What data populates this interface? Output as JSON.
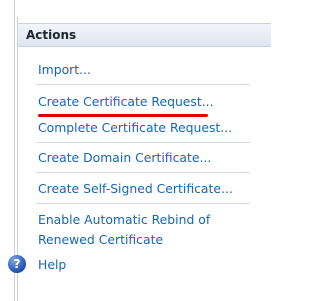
{
  "actions_panel": {
    "title": "Actions",
    "items": [
      {
        "label": "Import..."
      },
      {
        "label": "Create Certificate Request..."
      },
      {
        "label": "Complete Certificate Request..."
      },
      {
        "label": "Create Domain Certificate..."
      },
      {
        "label": "Create Self-Signed Certificate..."
      },
      {
        "label": "Enable Automatic Rebind of Renewed Certificate"
      }
    ],
    "help": {
      "label": "Help",
      "icon": "help-icon"
    }
  },
  "colors": {
    "link": "#1566b8",
    "annotation": "#e00000",
    "header_bg": "#dde5ef"
  }
}
